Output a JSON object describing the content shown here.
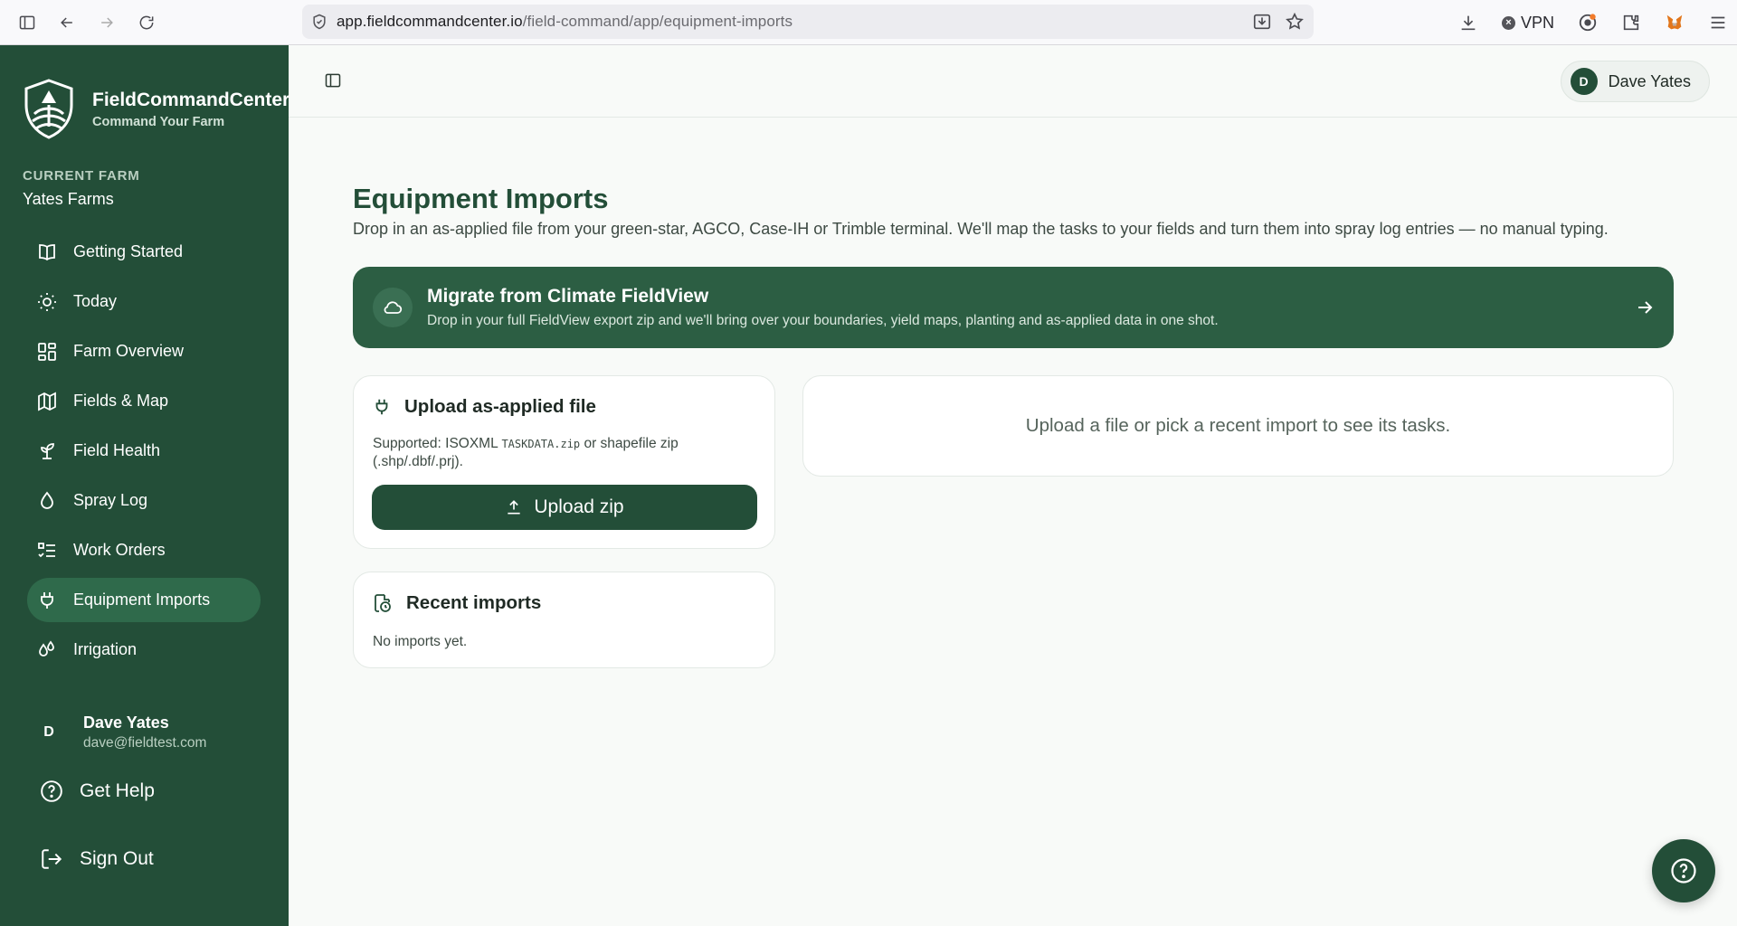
{
  "browser": {
    "url_host": "app.fieldcommandcenter.io",
    "url_path": "/field-command/app/equipment-imports",
    "vpn_label": "VPN"
  },
  "sidebar": {
    "app_name": "FieldCommandCenter",
    "tagline": "Command Your Farm",
    "current_farm_label": "CURRENT FARM",
    "farm_name": "Yates Farms",
    "items": [
      {
        "label": "Getting Started",
        "icon": "book-icon"
      },
      {
        "label": "Today",
        "icon": "sun-icon"
      },
      {
        "label": "Farm Overview",
        "icon": "grid-icon"
      },
      {
        "label": "Fields & Map",
        "icon": "map-icon"
      },
      {
        "label": "Field Health",
        "icon": "sprout-icon"
      },
      {
        "label": "Spray Log",
        "icon": "droplet-icon"
      },
      {
        "label": "Work Orders",
        "icon": "list-checks-icon"
      },
      {
        "label": "Equipment Imports",
        "icon": "plug-icon",
        "active": true
      },
      {
        "label": "Irrigation",
        "icon": "droplets-icon"
      }
    ],
    "user": {
      "initial": "D",
      "name": "Dave Yates",
      "email": "dave@fieldtest.com"
    },
    "get_help": "Get Help",
    "sign_out": "Sign Out"
  },
  "topbar": {
    "user_initial": "D",
    "user_name": "Dave Yates"
  },
  "main": {
    "title": "Equipment Imports",
    "subtitle": "Drop in an as-applied file from your green-star, AGCO, Case-IH or Trimble terminal. We'll map the tasks to your fields and turn them into spray log entries — no manual typing.",
    "banner": {
      "title": "Migrate from Climate FieldView",
      "description": "Drop in your full FieldView export zip and we'll bring over your boundaries, yield maps, planting and as-applied data in one shot."
    },
    "upload_card": {
      "title": "Upload as-applied file",
      "supported_prefix": "Supported: ISOXML ",
      "supported_code": "TASKDATA.zip",
      "supported_suffix": " or shapefile zip (.shp/.dbf/.prj).",
      "button_label": "Upload zip"
    },
    "recent_card": {
      "title": "Recent imports",
      "empty": "No imports yet."
    },
    "tasks_placeholder": "Upload a file or pick a recent import to see its tasks."
  },
  "colors": {
    "sidebar_bg": "#234e38",
    "accent": "#2c5e43",
    "active_item": "#2f6a4b"
  }
}
